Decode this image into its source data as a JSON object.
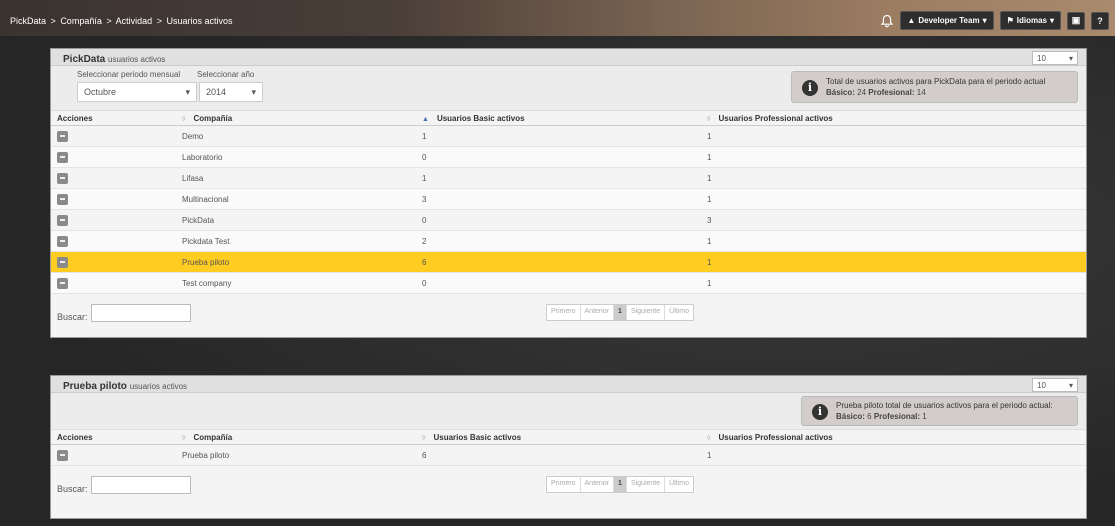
{
  "breadcrumb": [
    "PickData",
    "Compañía",
    "Actividad",
    "Usuarios activos"
  ],
  "breadcrumb_sep": ">",
  "topbar": {
    "bell_icon": "bell-icon",
    "team_label": "Developer Team",
    "languages_label": "Idiomas",
    "help_label": "?"
  },
  "panel1": {
    "title": "PickData",
    "title_suffix": "usuarios activos",
    "page_size": "10",
    "month_label": "Seleccionar periodo mensual",
    "year_label": "Seleccionar año",
    "month_value": "Octubre",
    "year_value": "2014",
    "info_line1": "Total de usuarios activos para PickData para el periodo actual",
    "info_basic_label": "Básico:",
    "info_basic_value": "24",
    "info_pro_label": "Profesional:",
    "info_pro_value": "14",
    "columns": [
      "Acciones",
      "Compañía",
      "Usuarios Basic activos",
      "Usuarios Professional activos"
    ],
    "rows": [
      {
        "company": "Demo",
        "basic": "1",
        "pro": "1"
      },
      {
        "company": "Laboratorio",
        "basic": "0",
        "pro": "1"
      },
      {
        "company": "Lifasa",
        "basic": "1",
        "pro": "1"
      },
      {
        "company": "Multinacional",
        "basic": "3",
        "pro": "1"
      },
      {
        "company": "PickData",
        "basic": "0",
        "pro": "3"
      },
      {
        "company": "Pickdata Test",
        "basic": "2",
        "pro": "1"
      },
      {
        "company": "Prueba piloto",
        "basic": "6",
        "pro": "1"
      },
      {
        "company": "Test company",
        "basic": "0",
        "pro": "1"
      }
    ],
    "search_label": "Buscar:",
    "pager": [
      "Primero",
      "Anterior",
      "1",
      "Siguiente",
      "Último"
    ]
  },
  "panel2": {
    "title": "Prueba piloto",
    "title_suffix": "usuarios activos",
    "page_size": "10",
    "info_line1": "Prueba piloto total de usuarios activos para el periodo actual:",
    "info_basic_label": "Básico:",
    "info_basic_value": "6",
    "info_pro_label": "Profesional:",
    "info_pro_value": "1",
    "columns": [
      "Acciones",
      "Compañía",
      "Usuarios Basic activos",
      "Usuarios Professional activos"
    ],
    "rows": [
      {
        "company": "Prueba piloto",
        "basic": "6",
        "pro": "1"
      }
    ],
    "search_label": "Buscar:",
    "pager": [
      "Primero",
      "Anterior",
      "1",
      "Siguiente",
      "Último"
    ]
  },
  "colors": {
    "highlight": "#ffcc22",
    "sort_active": "#4a6fb5"
  }
}
